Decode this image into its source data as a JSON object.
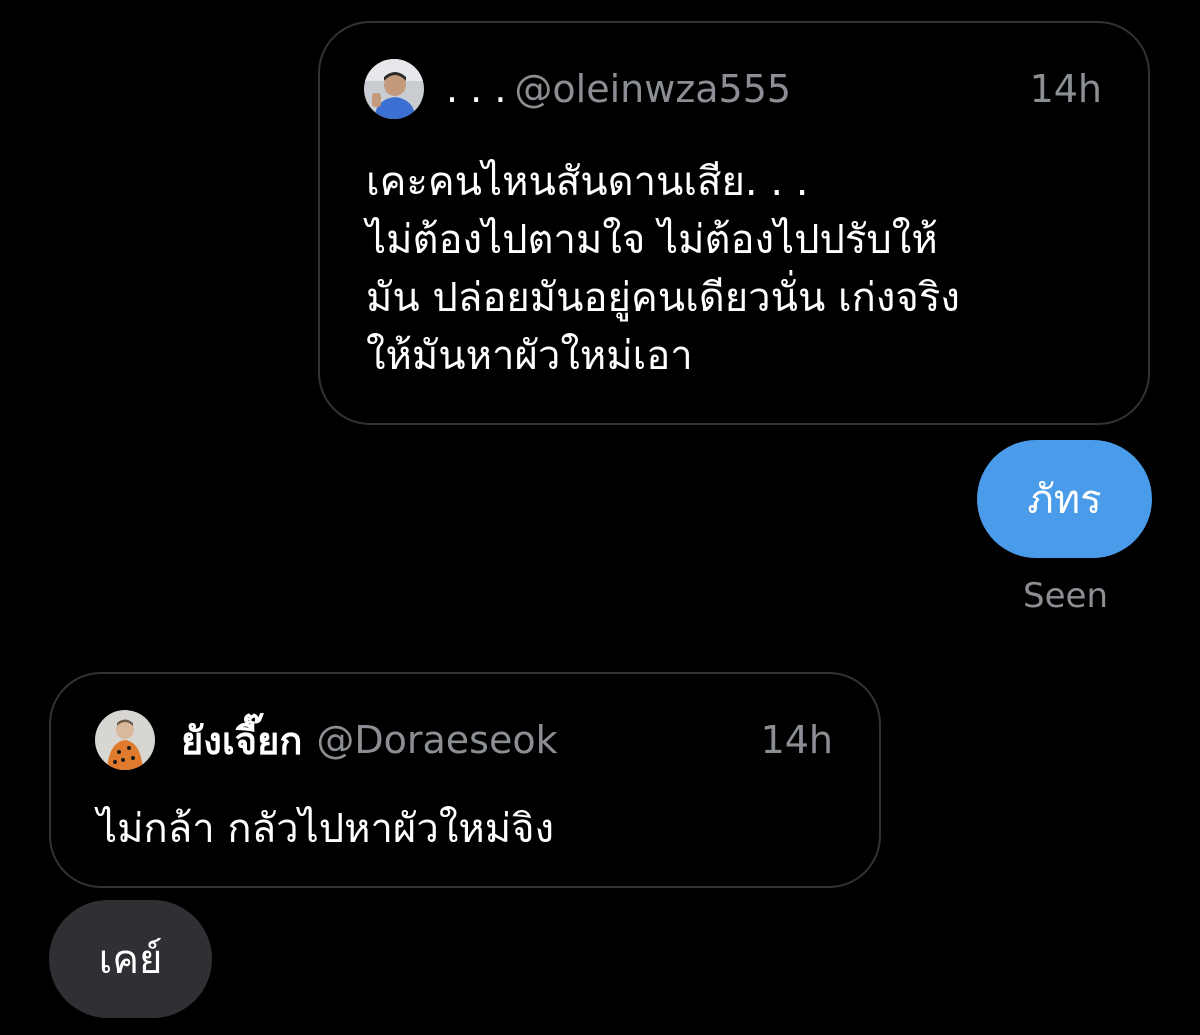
{
  "messages": [
    {
      "type": "quote",
      "author": {
        "name": ". . .",
        "handle": "@oleinwza555",
        "avatar_icon": "user-avatar-photo"
      },
      "timestamp": "14h",
      "text": "เคะคนไหนสันดานเสีย. . .\nไม่ต้องไปตามใจ ไม่ต้องไปปรับให้\nมัน ปล่อยมันอยู่คนเดียวนั่น เก่งจริง\nให้มันหาผัวใหม่เอา"
    },
    {
      "type": "sent",
      "text": "ภัทร",
      "status": "Seen"
    },
    {
      "type": "quote",
      "author": {
        "name": "ยังเจี๊ยก",
        "handle": "@Doraeseok",
        "avatar_icon": "user-avatar-photo"
      },
      "timestamp": "14h",
      "text": "ไม่กล้า กลัวไปหาผัวใหม่จิง"
    },
    {
      "type": "received",
      "text": "เคย์"
    }
  ],
  "colors": {
    "background": "#000000",
    "sent_bubble": "#4a9be9",
    "received_bubble": "#2f3033",
    "card_border": "#2f3336",
    "secondary_text": "#8b8f94"
  }
}
